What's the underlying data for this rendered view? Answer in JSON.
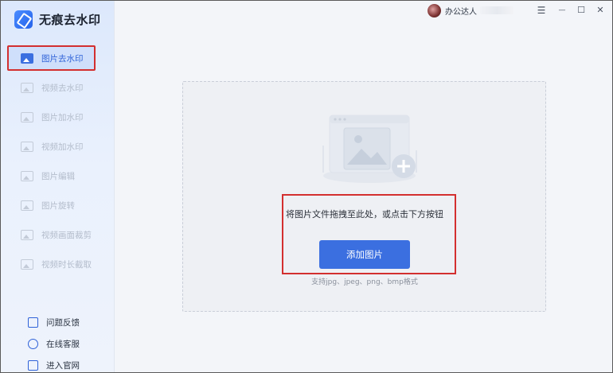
{
  "app": {
    "title": "无痕去水印"
  },
  "sidebar": {
    "items": [
      {
        "label": "图片去水印",
        "active": true
      },
      {
        "label": "视频去水印",
        "active": false
      },
      {
        "label": "图片加水印",
        "active": false
      },
      {
        "label": "视频加水印",
        "active": false
      },
      {
        "label": "图片编辑",
        "active": false
      },
      {
        "label": "图片旋转",
        "active": false
      },
      {
        "label": "视频画面裁剪",
        "active": false
      },
      {
        "label": "视频时长截取",
        "active": false
      }
    ],
    "bottom_links": [
      {
        "label": "问题反馈",
        "icon": "feedback-icon"
      },
      {
        "label": "在线客服",
        "icon": "customer-service-icon"
      },
      {
        "label": "进入官网",
        "icon": "website-icon"
      }
    ]
  },
  "titlebar": {
    "username": "办公达人",
    "menu_glyph": "☰",
    "minimize_glyph": "—",
    "maximize_glyph": "☐",
    "close_glyph": "✕"
  },
  "dropzone": {
    "hint": "将图片文件拖拽至此处，或点击下方按钮",
    "add_button": "添加图片",
    "formats": "支持jpg、jpeg、png、bmp格式"
  },
  "colors": {
    "accent": "#3b6fe0",
    "highlight": "#d32f2f"
  }
}
